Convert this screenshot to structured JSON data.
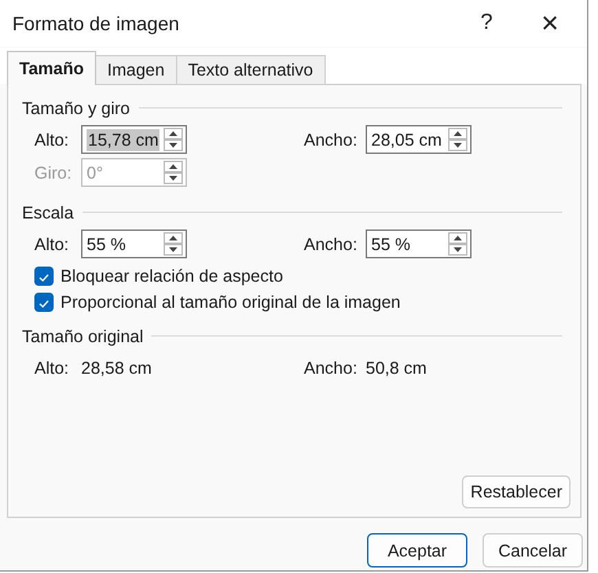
{
  "window": {
    "title": "Formato de imagen",
    "help": "?",
    "close": "×"
  },
  "tabs": [
    {
      "label": "Tamaño",
      "selected": true
    },
    {
      "label": "Imagen",
      "selected": false
    },
    {
      "label": "Texto alternativo",
      "selected": false
    }
  ],
  "sections": [
    {
      "title": "Tamaño y giro",
      "rows": [
        {
          "kind": "spin-pair",
          "fields": [
            {
              "label": "Alto:",
              "value": "15,78 cm",
              "highlighted": true,
              "disabled": false
            },
            {
              "label": "Ancho:",
              "value": "28,05 cm",
              "highlighted": false,
              "disabled": false
            }
          ]
        },
        {
          "kind": "spin-pair",
          "fields": [
            {
              "label": "Giro:",
              "value": "0°",
              "highlighted": false,
              "disabled": true
            }
          ]
        }
      ]
    },
    {
      "title": "Escala",
      "rows": [
        {
          "kind": "spin-pair",
          "fields": [
            {
              "label": "Alto:",
              "value": "55 %",
              "highlighted": false,
              "disabled": false
            },
            {
              "label": "Ancho:",
              "value": "55 %",
              "highlighted": false,
              "disabled": false
            }
          ]
        },
        {
          "kind": "checkbox",
          "label": "Bloquear relación de aspecto",
          "checked": true
        },
        {
          "kind": "checkbox",
          "label": "Proporcional al tamaño original de la imagen",
          "checked": true
        }
      ]
    },
    {
      "title": "Tamaño original",
      "rows": [
        {
          "kind": "readout",
          "fields": [
            {
              "label": "Alto:",
              "value": "28,58 cm"
            },
            {
              "label": "Ancho:",
              "value": "50,8 cm"
            }
          ]
        }
      ]
    }
  ],
  "reset_button": "Restablecer",
  "buttons": [
    {
      "label": "Aceptar",
      "default": true
    },
    {
      "label": "Cancelar",
      "default": false
    }
  ]
}
